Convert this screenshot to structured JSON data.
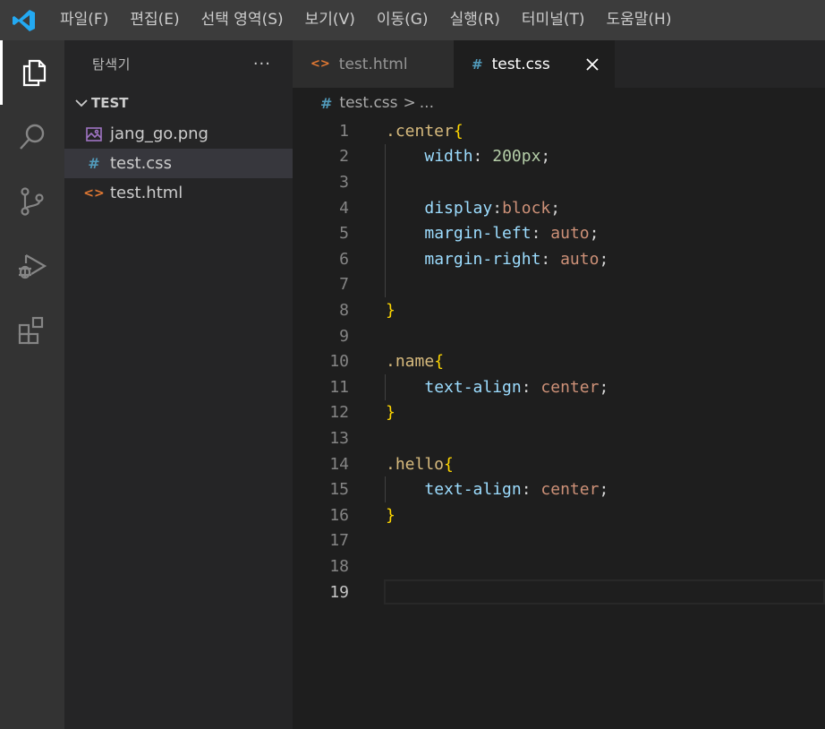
{
  "menu": {
    "items": [
      "파일(F)",
      "편집(E)",
      "선택 영역(S)",
      "보기(V)",
      "이동(G)",
      "실행(R)",
      "터미널(T)",
      "도움말(H)"
    ]
  },
  "activity_bar": {
    "items": [
      "explorer-icon",
      "search-icon",
      "source-control-icon",
      "run-debug-icon",
      "extensions-icon"
    ],
    "active": "explorer-icon"
  },
  "sidebar": {
    "title": "탐색기",
    "more_label": "···",
    "folder": "TEST",
    "files": [
      {
        "name": "jang_go.png",
        "icon": "image-file-icon",
        "selected": false
      },
      {
        "name": "test.css",
        "icon": "css-file-icon",
        "selected": true
      },
      {
        "name": "test.html",
        "icon": "html-file-icon",
        "selected": false
      }
    ]
  },
  "tabs": [
    {
      "label": "test.html",
      "icon_glyph": "<>",
      "active": false
    },
    {
      "label": "test.css",
      "icon_glyph": "#",
      "active": true
    }
  ],
  "breadcrumb": {
    "icon_glyph": "#",
    "file": "test.css",
    "separator": ">",
    "rest": "..."
  },
  "editor": {
    "current_line": 19,
    "lines": [
      [
        {
          "t": ".center",
          "c": "sel"
        },
        {
          "t": "{",
          "c": "brace"
        }
      ],
      [
        {
          "t": "    "
        },
        {
          "t": "width",
          "c": "prop"
        },
        {
          "t": ": ",
          "c": "punc"
        },
        {
          "t": "200px",
          "c": "num"
        },
        {
          "t": ";",
          "c": "punc"
        }
      ],
      [],
      [
        {
          "t": "    "
        },
        {
          "t": "display",
          "c": "prop"
        },
        {
          "t": ":",
          "c": "punc"
        },
        {
          "t": "block",
          "c": "val"
        },
        {
          "t": ";",
          "c": "punc"
        }
      ],
      [
        {
          "t": "    "
        },
        {
          "t": "margin-left",
          "c": "prop"
        },
        {
          "t": ": ",
          "c": "punc"
        },
        {
          "t": "auto",
          "c": "val"
        },
        {
          "t": ";",
          "c": "punc"
        }
      ],
      [
        {
          "t": "    "
        },
        {
          "t": "margin-right",
          "c": "prop"
        },
        {
          "t": ": ",
          "c": "punc"
        },
        {
          "t": "auto",
          "c": "val"
        },
        {
          "t": ";",
          "c": "punc"
        }
      ],
      [],
      [
        {
          "t": "}",
          "c": "brace"
        }
      ],
      [],
      [
        {
          "t": ".name",
          "c": "sel"
        },
        {
          "t": "{",
          "c": "brace"
        }
      ],
      [
        {
          "t": "    "
        },
        {
          "t": "text-align",
          "c": "prop"
        },
        {
          "t": ": ",
          "c": "punc"
        },
        {
          "t": "center",
          "c": "val"
        },
        {
          "t": ";",
          "c": "punc"
        }
      ],
      [
        {
          "t": "}",
          "c": "brace"
        }
      ],
      [],
      [
        {
          "t": ".hello",
          "c": "sel"
        },
        {
          "t": "{",
          "c": "brace"
        }
      ],
      [
        {
          "t": "    "
        },
        {
          "t": "text-align",
          "c": "prop"
        },
        {
          "t": ": ",
          "c": "punc"
        },
        {
          "t": "center",
          "c": "val"
        },
        {
          "t": ";",
          "c": "punc"
        }
      ],
      [
        {
          "t": "}",
          "c": "brace"
        }
      ],
      [],
      [],
      []
    ]
  },
  "colors": {
    "accent": "#3794ff",
    "css_icon": "#519aba",
    "html_icon": "#e37933",
    "image_icon": "#a074c4"
  }
}
